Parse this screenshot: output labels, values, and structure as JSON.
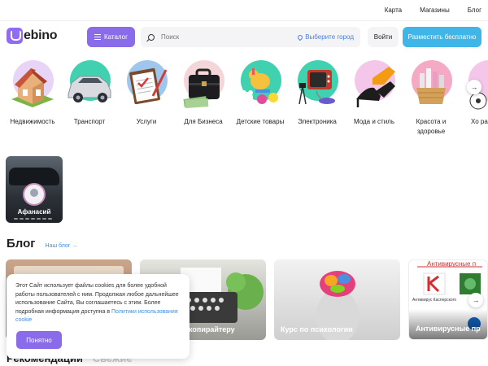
{
  "topbar": {
    "links": [
      "Карта",
      "Магазины",
      "Блог"
    ]
  },
  "header": {
    "logo_text": "ebino",
    "catalog_label": "Каталог",
    "search_placeholder": "Поиск",
    "city_label": "Выберите город",
    "login_label": "Войти",
    "post_label": "Разместить бесплатно"
  },
  "categories": [
    {
      "label": "Недвижимость",
      "icon": "house-icon",
      "color": "#e7d4f7"
    },
    {
      "label": "Транспорт",
      "icon": "car-icon",
      "color": "#3fd1b0"
    },
    {
      "label": "Услуги",
      "icon": "clipboard-icon",
      "color": "#9fc6ec"
    },
    {
      "label": "Для Бизнеса",
      "icon": "briefcase-icon",
      "color": "#f4d5d8"
    },
    {
      "label": "Детские товары",
      "icon": "toy-icon",
      "color": "#3fd1b0"
    },
    {
      "label": "Электроника",
      "icon": "tv-icon",
      "color": "#3fd1b0"
    },
    {
      "label": "Мода и стиль",
      "icon": "shoe-icon",
      "color": "#f4c7ea"
    },
    {
      "label": "Красота и здоровье",
      "icon": "cosmetics-icon",
      "color": "#f4a9c5"
    },
    {
      "label": "Хо разв",
      "icon": "ball-icon",
      "color": "#f4c7ea"
    }
  ],
  "story": {
    "name": "Афанасий"
  },
  "blog": {
    "title": "Блог",
    "link": "Наш блог →",
    "cards": [
      {
        "caption": ""
      },
      {
        "caption": "копирайтеру"
      },
      {
        "caption": "Курс по психологии"
      },
      {
        "caption": "Антивирусные пр"
      }
    ],
    "card3_banner": "Антивирусные п",
    "card3_sub": "Антивирус Касперского"
  },
  "cookie": {
    "text": "Этот Сайт использует файлы cookies для более удобной работы пользователей с ним. Продолжая любое дальнейшее использование Сайта, Вы соглашаетесь с этим. Более подробная информация доступна в",
    "link": "Политики использования cookie",
    "button": "Понятно"
  },
  "recommendations": {
    "active": "Рекомендации",
    "inactive": "Свежие"
  }
}
